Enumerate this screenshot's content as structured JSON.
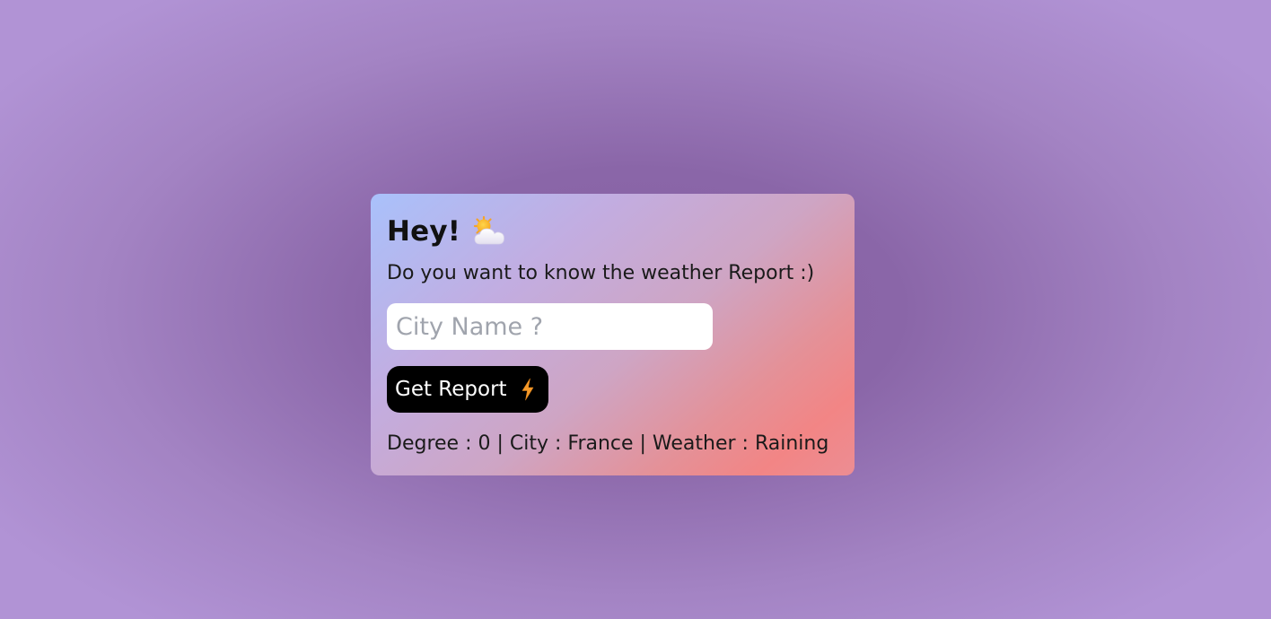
{
  "card": {
    "greeting": "Hey!",
    "greeting_icon": "sun-behind-cloud-icon",
    "subtitle": "Do you want to know the weather Report :)"
  },
  "search": {
    "placeholder": "City Name ?",
    "value": ""
  },
  "button": {
    "label": "Get Report",
    "icon": "lightning-bolt-icon"
  },
  "result": {
    "text": "Degree : 0 | City : France | Weather : Raining"
  },
  "colors": {
    "background": "#8560a2",
    "card_gradient_start": "#a9c1fb",
    "card_gradient_end": "#f28585",
    "button": "#000000",
    "bolt": "#f59a2a"
  }
}
